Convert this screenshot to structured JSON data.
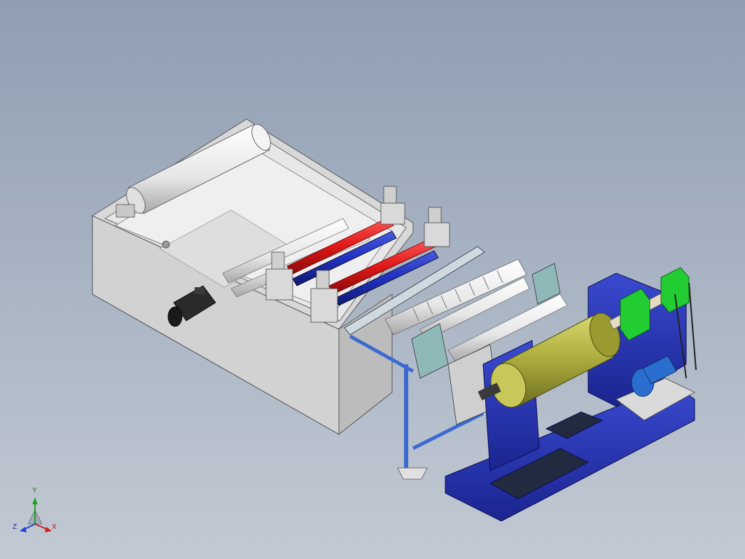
{
  "viewport": {
    "background_top": "#8f9eb2",
    "background_bottom": "#c2c9d3"
  },
  "model": {
    "description_colors": {
      "housing": "#dcdcdc",
      "frame": "#2233aa",
      "red_roller": "#e01818",
      "blue_roller": "#2030c0",
      "rewind_roll": "#a8a838",
      "bearing_block": "#22cc33",
      "motor": "#2a6fd0"
    }
  },
  "triad": {
    "x_label": "X",
    "y_label": "Y",
    "z_label": "Z",
    "x_color": "#d02020",
    "y_color": "#20a020",
    "z_color": "#2040d0"
  }
}
